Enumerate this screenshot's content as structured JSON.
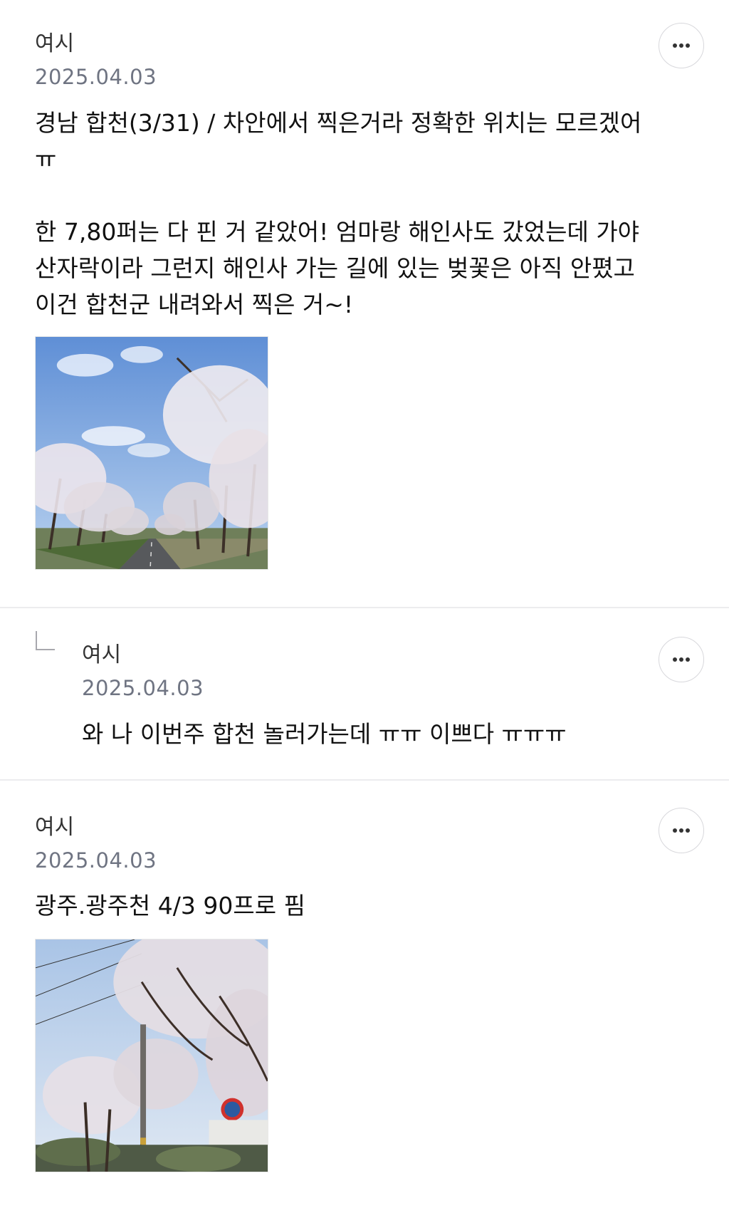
{
  "comments": [
    {
      "author": "여시",
      "date": "2025.04.03",
      "text": "경남 합천(3/31) / 차안에서 찍은거라 정확한 위치는 모르겠어\nㅠ\n\n한 7,80퍼는 다 핀 거 같았어! 엄마랑 해인사도 갔었는데 가야\n산자락이라 그런지 해인사 가는 길에 있는 벚꽃은 아직 안폈고\n이건 합천군 내려와서 찍은 거~!",
      "photo": "cherry-blossom-road-photo",
      "more_icon": "more-horizontal-icon"
    },
    {
      "author": "여시",
      "date": "2025.04.03",
      "text": "와 나 이번주 합천 놀러가는데 ㅠㅠ 이쁘다 ㅠㅠㅠ",
      "is_reply": true,
      "reply_icon": "reply-arrow-icon",
      "more_icon": "more-horizontal-icon"
    },
    {
      "author": "여시",
      "date": "2025.04.03",
      "text": "광주.광주천 4/3 90프로 핌",
      "photo": "cherry-blossom-street-photo",
      "more_icon": "more-horizontal-icon"
    }
  ],
  "colors": {
    "date": "#6f7482",
    "divider": "#ececee",
    "button_border": "#d8d8dc"
  }
}
